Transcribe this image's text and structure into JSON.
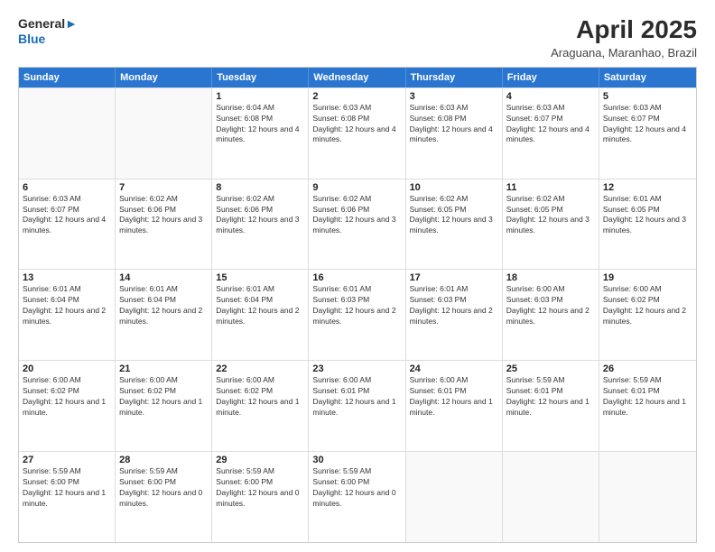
{
  "header": {
    "logo_line1": "General",
    "logo_line2": "Blue",
    "month": "April 2025",
    "location": "Araguana, Maranhao, Brazil"
  },
  "days_of_week": [
    "Sunday",
    "Monday",
    "Tuesday",
    "Wednesday",
    "Thursday",
    "Friday",
    "Saturday"
  ],
  "weeks": [
    [
      {
        "day": "",
        "sunrise": "",
        "sunset": "",
        "daylight": ""
      },
      {
        "day": "",
        "sunrise": "",
        "sunset": "",
        "daylight": ""
      },
      {
        "day": "1",
        "sunrise": "Sunrise: 6:04 AM",
        "sunset": "Sunset: 6:08 PM",
        "daylight": "Daylight: 12 hours and 4 minutes."
      },
      {
        "day": "2",
        "sunrise": "Sunrise: 6:03 AM",
        "sunset": "Sunset: 6:08 PM",
        "daylight": "Daylight: 12 hours and 4 minutes."
      },
      {
        "day": "3",
        "sunrise": "Sunrise: 6:03 AM",
        "sunset": "Sunset: 6:08 PM",
        "daylight": "Daylight: 12 hours and 4 minutes."
      },
      {
        "day": "4",
        "sunrise": "Sunrise: 6:03 AM",
        "sunset": "Sunset: 6:07 PM",
        "daylight": "Daylight: 12 hours and 4 minutes."
      },
      {
        "day": "5",
        "sunrise": "Sunrise: 6:03 AM",
        "sunset": "Sunset: 6:07 PM",
        "daylight": "Daylight: 12 hours and 4 minutes."
      }
    ],
    [
      {
        "day": "6",
        "sunrise": "Sunrise: 6:03 AM",
        "sunset": "Sunset: 6:07 PM",
        "daylight": "Daylight: 12 hours and 4 minutes."
      },
      {
        "day": "7",
        "sunrise": "Sunrise: 6:02 AM",
        "sunset": "Sunset: 6:06 PM",
        "daylight": "Daylight: 12 hours and 3 minutes."
      },
      {
        "day": "8",
        "sunrise": "Sunrise: 6:02 AM",
        "sunset": "Sunset: 6:06 PM",
        "daylight": "Daylight: 12 hours and 3 minutes."
      },
      {
        "day": "9",
        "sunrise": "Sunrise: 6:02 AM",
        "sunset": "Sunset: 6:06 PM",
        "daylight": "Daylight: 12 hours and 3 minutes."
      },
      {
        "day": "10",
        "sunrise": "Sunrise: 6:02 AM",
        "sunset": "Sunset: 6:05 PM",
        "daylight": "Daylight: 12 hours and 3 minutes."
      },
      {
        "day": "11",
        "sunrise": "Sunrise: 6:02 AM",
        "sunset": "Sunset: 6:05 PM",
        "daylight": "Daylight: 12 hours and 3 minutes."
      },
      {
        "day": "12",
        "sunrise": "Sunrise: 6:01 AM",
        "sunset": "Sunset: 6:05 PM",
        "daylight": "Daylight: 12 hours and 3 minutes."
      }
    ],
    [
      {
        "day": "13",
        "sunrise": "Sunrise: 6:01 AM",
        "sunset": "Sunset: 6:04 PM",
        "daylight": "Daylight: 12 hours and 2 minutes."
      },
      {
        "day": "14",
        "sunrise": "Sunrise: 6:01 AM",
        "sunset": "Sunset: 6:04 PM",
        "daylight": "Daylight: 12 hours and 2 minutes."
      },
      {
        "day": "15",
        "sunrise": "Sunrise: 6:01 AM",
        "sunset": "Sunset: 6:04 PM",
        "daylight": "Daylight: 12 hours and 2 minutes."
      },
      {
        "day": "16",
        "sunrise": "Sunrise: 6:01 AM",
        "sunset": "Sunset: 6:03 PM",
        "daylight": "Daylight: 12 hours and 2 minutes."
      },
      {
        "day": "17",
        "sunrise": "Sunrise: 6:01 AM",
        "sunset": "Sunset: 6:03 PM",
        "daylight": "Daylight: 12 hours and 2 minutes."
      },
      {
        "day": "18",
        "sunrise": "Sunrise: 6:00 AM",
        "sunset": "Sunset: 6:03 PM",
        "daylight": "Daylight: 12 hours and 2 minutes."
      },
      {
        "day": "19",
        "sunrise": "Sunrise: 6:00 AM",
        "sunset": "Sunset: 6:02 PM",
        "daylight": "Daylight: 12 hours and 2 minutes."
      }
    ],
    [
      {
        "day": "20",
        "sunrise": "Sunrise: 6:00 AM",
        "sunset": "Sunset: 6:02 PM",
        "daylight": "Daylight: 12 hours and 1 minute."
      },
      {
        "day": "21",
        "sunrise": "Sunrise: 6:00 AM",
        "sunset": "Sunset: 6:02 PM",
        "daylight": "Daylight: 12 hours and 1 minute."
      },
      {
        "day": "22",
        "sunrise": "Sunrise: 6:00 AM",
        "sunset": "Sunset: 6:02 PM",
        "daylight": "Daylight: 12 hours and 1 minute."
      },
      {
        "day": "23",
        "sunrise": "Sunrise: 6:00 AM",
        "sunset": "Sunset: 6:01 PM",
        "daylight": "Daylight: 12 hours and 1 minute."
      },
      {
        "day": "24",
        "sunrise": "Sunrise: 6:00 AM",
        "sunset": "Sunset: 6:01 PM",
        "daylight": "Daylight: 12 hours and 1 minute."
      },
      {
        "day": "25",
        "sunrise": "Sunrise: 5:59 AM",
        "sunset": "Sunset: 6:01 PM",
        "daylight": "Daylight: 12 hours and 1 minute."
      },
      {
        "day": "26",
        "sunrise": "Sunrise: 5:59 AM",
        "sunset": "Sunset: 6:01 PM",
        "daylight": "Daylight: 12 hours and 1 minute."
      }
    ],
    [
      {
        "day": "27",
        "sunrise": "Sunrise: 5:59 AM",
        "sunset": "Sunset: 6:00 PM",
        "daylight": "Daylight: 12 hours and 1 minute."
      },
      {
        "day": "28",
        "sunrise": "Sunrise: 5:59 AM",
        "sunset": "Sunset: 6:00 PM",
        "daylight": "Daylight: 12 hours and 0 minutes."
      },
      {
        "day": "29",
        "sunrise": "Sunrise: 5:59 AM",
        "sunset": "Sunset: 6:00 PM",
        "daylight": "Daylight: 12 hours and 0 minutes."
      },
      {
        "day": "30",
        "sunrise": "Sunrise: 5:59 AM",
        "sunset": "Sunset: 6:00 PM",
        "daylight": "Daylight: 12 hours and 0 minutes."
      },
      {
        "day": "",
        "sunrise": "",
        "sunset": "",
        "daylight": ""
      },
      {
        "day": "",
        "sunrise": "",
        "sunset": "",
        "daylight": ""
      },
      {
        "day": "",
        "sunrise": "",
        "sunset": "",
        "daylight": ""
      }
    ]
  ]
}
